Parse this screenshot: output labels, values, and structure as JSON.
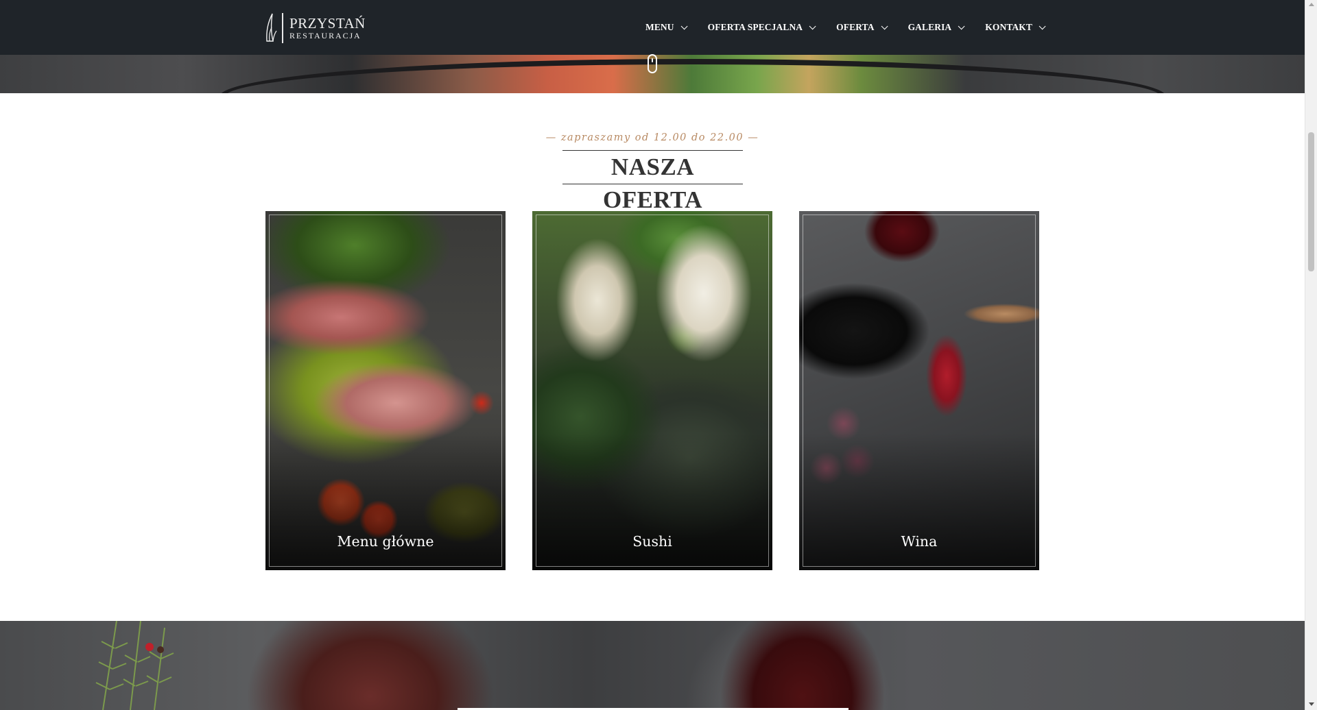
{
  "brand": {
    "title": "PRZYSTAŃ",
    "subtitle": "RESTAURACJA"
  },
  "nav": {
    "items": [
      {
        "label": "MENU"
      },
      {
        "label": "OFERTA SPECJALNA"
      },
      {
        "label": "OFERTA"
      },
      {
        "label": "GALERIA"
      },
      {
        "label": "KONTAKT"
      }
    ]
  },
  "offer": {
    "hours": "— zapraszamy od 12.00 do 22.00 —",
    "heading": "NASZA OFERTA",
    "cards": [
      {
        "label": "Menu główne"
      },
      {
        "label": "Sushi"
      },
      {
        "label": "Wina"
      }
    ]
  },
  "colors": {
    "topbar": "#1f2429",
    "accent": "#b88a63",
    "heading": "#333333"
  }
}
